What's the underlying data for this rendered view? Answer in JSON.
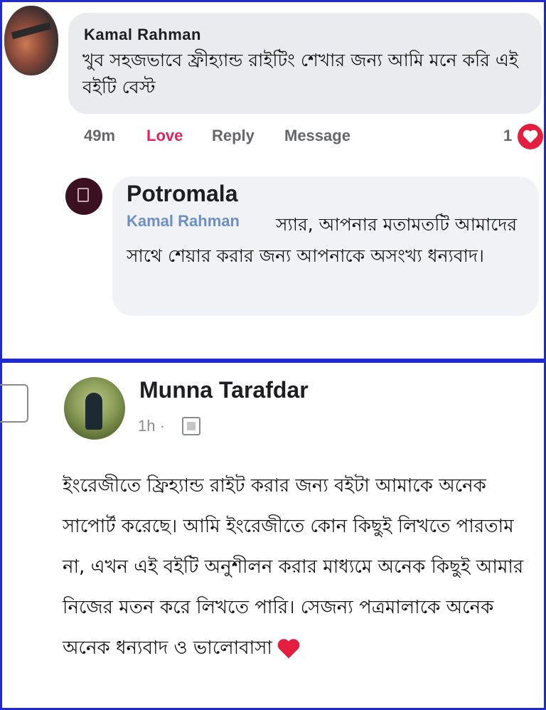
{
  "comment": {
    "author": "Kamal Rahman",
    "text": "খুব সহজভাবে ফ্রীহ্যান্ড রাইটিং শেখার জন্য আমি মনে করি এই বইটি বেস্ট",
    "time": "49m",
    "actions": {
      "love": "Love",
      "reply": "Reply",
      "message": "Message"
    },
    "reaction_count": "1",
    "reaction_color": "#e41e3f"
  },
  "reply": {
    "author": "Potromala",
    "mention": "Kamal Rahman",
    "text": "স্যার, আপনার মতামতটি আমাদের সাথে শেয়ার করার জন্য আপনাকে অসংখ্য ধন্যবাদ।"
  },
  "post": {
    "author": "Munna Tarafdar",
    "time": "1h ·",
    "text": "ইংরেজীতে ফ্রিহ্যান্ড রাইট করার জন্য বইটা আমাকে অনেক সাপোর্ট করেছে। আমি ইংরেজীতে কোন কিছুই লিখতে পারতাম না, এখন এই বইটি অনুশীলন করার মাধ্যমে অনেক কিছুই আমার নিজের মতন করে লিখতে পারি। সেজন্য পত্রমালাকে অনেক অনেক ধন্যবাদ ও ভালোবাসা",
    "heart_color": "#e41e3f"
  },
  "icons": [
    "heart-icon",
    "globe-icon",
    "checkbox-icon"
  ],
  "frame_color": "#1f2bd1"
}
